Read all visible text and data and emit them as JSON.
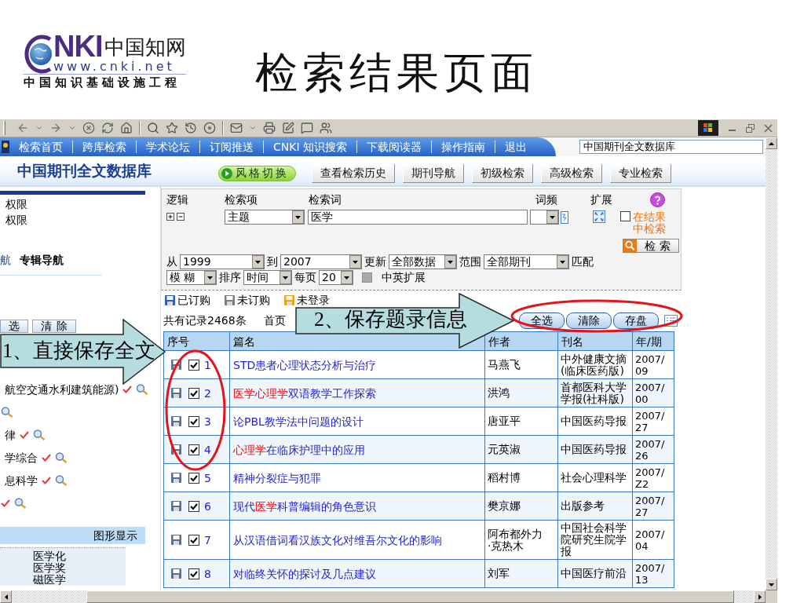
{
  "logo": {
    "wordmark": "NKI",
    "name": "中国知网",
    "url": "www.cnki.net",
    "tagline": "中国知识基础设施工程"
  },
  "slide_title": "检索结果页面",
  "browser": {
    "nav_links": [
      "检索首页",
      "跨库检索",
      "学术论坛",
      "订阅推送",
      "CNKI 知识搜索",
      "下载阅读器",
      "操作指南",
      "退出"
    ],
    "database_field": {
      "value": "中国期刊全文数据库"
    }
  },
  "database": {
    "title": "中国期刊全文数据库",
    "buttons": [
      {
        "label": "风格切换",
        "kind": "switch"
      },
      {
        "label": "查看检索历史",
        "kind": "tab"
      },
      {
        "label": "期刊导航",
        "kind": "tab"
      },
      {
        "label": "初级检索",
        "kind": "tab"
      },
      {
        "label": "高级检索",
        "kind": "tab"
      },
      {
        "label": "专业检索",
        "kind": "tab"
      }
    ]
  },
  "sidebar": {
    "lines": [
      "权限",
      "权限"
    ],
    "nav_tabs": [
      {
        "label": "航",
        "selected": false
      },
      {
        "label": "专辑导航",
        "selected": true
      }
    ],
    "buttons": [
      "选",
      "清除"
    ],
    "categories": [
      {
        "label": "航空交通水利建筑能源)",
        "checked": true
      },
      {
        "checked": false
      },
      {
        "label": "律",
        "checked": true
      },
      {
        "label": "学综合",
        "checked": true
      },
      {
        "label": "息科学",
        "checked": true
      },
      {
        "checked": true
      }
    ],
    "graph": {
      "title": "图形显示",
      "items": [
        "医学化",
        "医学奖",
        "磁医学"
      ]
    }
  },
  "search_form": {
    "headers": [
      "逻辑",
      "检索项",
      "检索词",
      "词频",
      "扩展"
    ],
    "field": {
      "value": "主题"
    },
    "term": {
      "value": "医学"
    },
    "within_results": {
      "label": "在结果中检索",
      "checked": false
    },
    "search_button": "检 索",
    "option_rows": [
      [
        {
          "kind": "label",
          "text": "从"
        },
        {
          "kind": "select",
          "value": "1999"
        },
        {
          "kind": "label",
          "text": "到"
        },
        {
          "kind": "select",
          "value": "2007"
        },
        {
          "kind": "label",
          "text": "更新"
        },
        {
          "kind": "select",
          "value": "全部数据"
        },
        {
          "kind": "label",
          "text": "范围"
        },
        {
          "kind": "select",
          "value": "全部期刊"
        },
        {
          "kind": "label",
          "text": "匹配"
        }
      ],
      [
        {
          "kind": "select",
          "value": "模 糊"
        },
        {
          "kind": "label",
          "text": "排序"
        },
        {
          "kind": "select",
          "value": "时间"
        },
        {
          "kind": "label",
          "text": "每页"
        },
        {
          "kind": "select",
          "value": "20"
        },
        {
          "kind": "checkbox",
          "label": "中英扩展",
          "checked": false,
          "disabled": true
        }
      ]
    ]
  },
  "results": {
    "legend": [
      {
        "label": "已订购",
        "color": "#2e5fb0"
      },
      {
        "label": "未订购",
        "color": "#7c7c7c"
      },
      {
        "label": "未登录",
        "color": "#e8a317"
      }
    ],
    "count": "共有记录2468条",
    "pager": "首页",
    "actions": [
      "全选",
      "清除",
      "存盘"
    ],
    "table": {
      "columns": [
        "序号",
        "篇名",
        "作者",
        "刊名",
        "年/期"
      ],
      "rows": [
        {
          "number": "1",
          "checked": true,
          "title": [
            {
              "text": "STD患者心理状态分析与治疗",
              "highlight": false
            }
          ],
          "author": "马燕飞",
          "journal": "中外健康文摘(临床医药版)",
          "issue": "2007/09"
        },
        {
          "number": "2",
          "checked": true,
          "title": [
            {
              "text": "医学心理学",
              "highlight": true
            },
            {
              "text": "双语教学工作探索",
              "highlight": false
            }
          ],
          "author": "洪鸿",
          "journal": "首都医科大学学报(社科版)",
          "issue": "2007/00"
        },
        {
          "number": "3",
          "checked": true,
          "title": [
            {
              "text": "论PBL教学法中问题的设计",
              "highlight": false
            }
          ],
          "author": "唐亚平",
          "journal": "中国医药导报",
          "issue": "2007/27"
        },
        {
          "number": "4",
          "checked": true,
          "title": [
            {
              "text": "心理学",
              "highlight": true
            },
            {
              "text": "在临床护理中的应用",
              "highlight": false
            }
          ],
          "author": "元英淑",
          "journal": "中国医药导报",
          "issue": "2007/26"
        },
        {
          "number": "5",
          "checked": true,
          "title": [
            {
              "text": "精神分裂症与犯罪",
              "highlight": false
            }
          ],
          "author": "稻村博",
          "journal": "社会心理科学",
          "issue": "2007/Z2"
        },
        {
          "number": "6",
          "checked": true,
          "title": [
            {
              "text": "现代",
              "highlight": false
            },
            {
              "text": "医学",
              "highlight": true
            },
            {
              "text": "科普编辑的角色意识",
              "highlight": false
            }
          ],
          "author": "樊京娜",
          "journal": "出版参考",
          "issue": "2007/27"
        },
        {
          "number": "7",
          "checked": true,
          "title": [
            {
              "text": "从汉语借词看汉族文化对维吾尔文化的影响",
              "highlight": false
            }
          ],
          "author": "阿布都外力·克热木",
          "journal": "中国社会科学院研究生院学报",
          "issue": "2007/04"
        },
        {
          "number": "8",
          "checked": true,
          "title": [
            {
              "text": "对临终关怀的探讨及几点建议",
              "highlight": false
            }
          ],
          "author": "刘军",
          "journal": "中国医疗前沿",
          "issue": "2007/13"
        }
      ]
    }
  },
  "annotations": [
    {
      "kind": "arrow",
      "text": "1、直接保存全文"
    },
    {
      "kind": "arrow",
      "text": "2、保存题录信息"
    },
    {
      "kind": "ellipse"
    },
    {
      "kind": "ellipse"
    }
  ]
}
